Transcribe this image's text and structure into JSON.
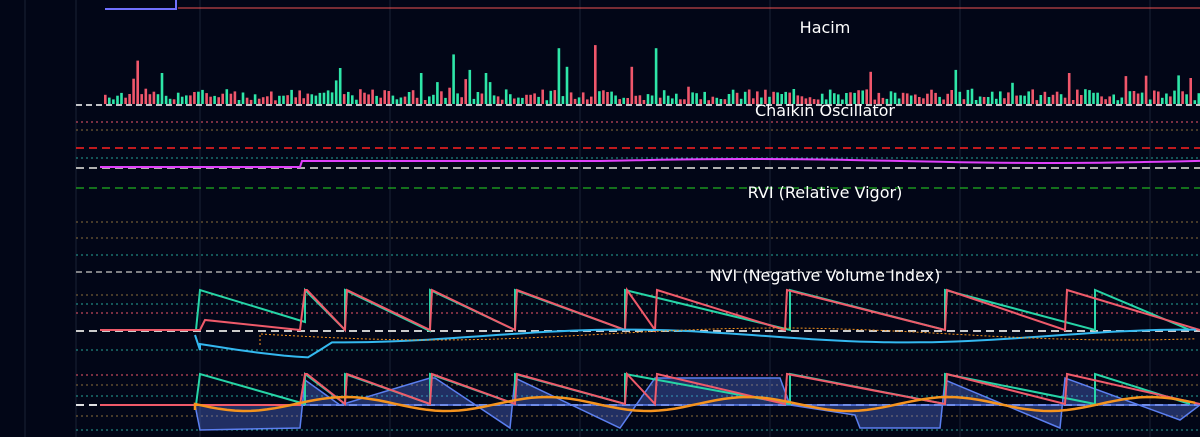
{
  "colors": {
    "background": "#020617",
    "up": "#2ee6a8",
    "down": "#f0566b",
    "magenta": "#e040fb",
    "teal": "#26d4a6",
    "coral": "#ef5a6a",
    "cyan": "#34b8f0",
    "orange": "#f5931e",
    "blue": "#5b7ff0",
    "axis": "#d9d9d9",
    "grid": "#1a2235"
  },
  "chart_data": [
    {
      "type": "bar",
      "title": "Hacim",
      "note_values": "relative volume per bar, 0-1 scale (axis unlabeled in source)",
      "ylim": [
        0,
        1
      ],
      "values_up_down": "random alternating green/red"
    },
    {
      "type": "line",
      "title": "Chaikin Oscillator",
      "ylim": [
        -1,
        1
      ]
    },
    {
      "type": "line",
      "title": "RVI (Relative Vigor)",
      "ylim": [
        -1,
        1
      ]
    },
    {
      "type": "line",
      "title": "NVI (Negative Volume Index)",
      "ylim": [
        -1,
        1
      ]
    },
    {
      "type": "line",
      "title": "",
      "ylim": [
        -1,
        1
      ]
    }
  ]
}
